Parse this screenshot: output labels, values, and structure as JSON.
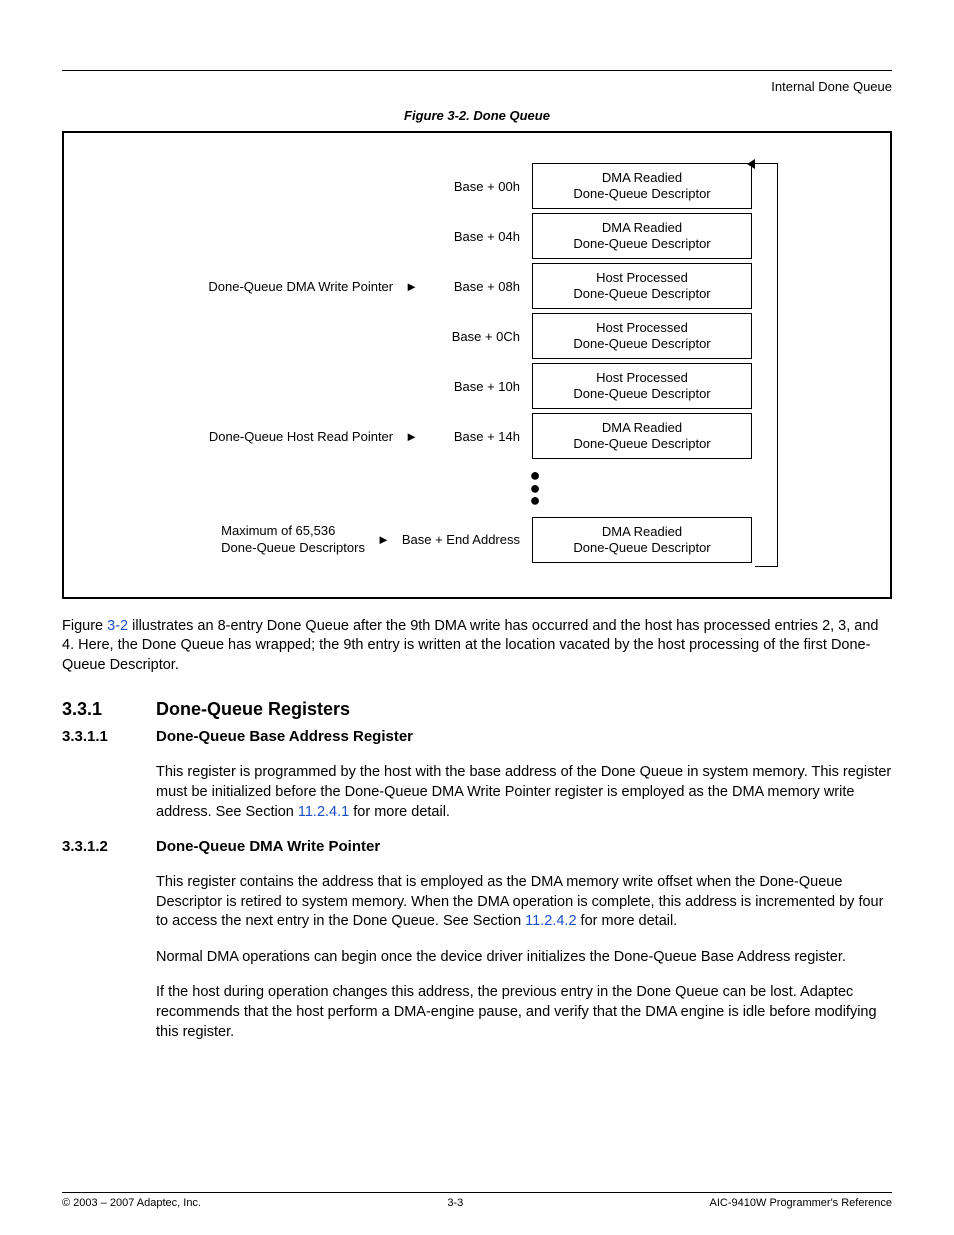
{
  "header": {
    "right": "Internal Done Queue"
  },
  "figure": {
    "title": "Figure 3-2. Done Queue",
    "rows": [
      {
        "left": "",
        "arrow": "",
        "addr": "Base + 00h",
        "l1": "DMA Readied",
        "l2": "Done-Queue Descriptor"
      },
      {
        "left": "",
        "arrow": "",
        "addr": "Base + 04h",
        "l1": "DMA Readied",
        "l2": "Done-Queue Descriptor"
      },
      {
        "left": "Done-Queue DMA Write Pointer",
        "arrow": "►",
        "addr": "Base + 08h",
        "l1": "Host Processed",
        "l2": "Done-Queue Descriptor"
      },
      {
        "left": "",
        "arrow": "",
        "addr": "Base + 0Ch",
        "l1": "Host Processed",
        "l2": "Done-Queue Descriptor"
      },
      {
        "left": "",
        "arrow": "",
        "addr": "Base + 10h",
        "l1": "Host Processed",
        "l2": "Done-Queue Descriptor"
      },
      {
        "left": "Done-Queue Host Read Pointer",
        "arrow": "►",
        "addr": "Base + 14h",
        "l1": "DMA Readied",
        "l2": "Done-Queue Descriptor"
      }
    ],
    "last": {
      "max_l1": "Maximum of 65,536",
      "max_l2": "Done-Queue Descriptors",
      "arrow": "►",
      "addr": "Base + End Address",
      "l1": "DMA Readied",
      "l2": "Done-Queue Descriptor"
    }
  },
  "body": {
    "p1a": "Figure ",
    "link1": "3-2",
    "p1b": " illustrates an 8-entry Done Queue after the 9th DMA write has occurred and the host has processed entries 2, 3, and 4. Here, the Done Queue has wrapped; the 9th entry is written at the location vacated by the host processing of the first Done-Queue Descriptor.",
    "s331_no": "3.3.1",
    "s331_title": "Done-Queue Registers",
    "s3311_no": "3.3.1.1",
    "s3311_title": "Done-Queue Base Address Register",
    "p2": "This register is programmed by the host with the base address of the Done Queue in system memory. This register must be initialized before the Done-Queue DMA Write Pointer register is employed as the DMA memory write address. See Section ",
    "link2": "11.2.4.1",
    "p2b": " for more detail.",
    "s3312_no": "3.3.1.2",
    "s3312_title": "Done-Queue DMA Write Pointer",
    "p3": "This register contains the address that is employed as the DMA memory write offset when the Done-Queue Descriptor is retired to system memory. When the DMA operation is complete, this address is incremented by four to access the next entry in the Done Queue. See Section ",
    "link3": "11.2.4.2",
    "p3b": " for more detail.",
    "p4": "Normal DMA operations can begin once the device driver initializes the Done-Queue Base Address register.",
    "p5": "If the host during operation changes this address, the previous entry in the Done Queue can be lost. Adaptec recommends that the host perform a DMA-engine pause, and verify that the DMA engine is idle before modifying this register."
  },
  "footer": {
    "left": "© 2003 – 2007 Adaptec, Inc.",
    "center": "3-3",
    "right": "AIC-9410W Programmer's Reference"
  }
}
